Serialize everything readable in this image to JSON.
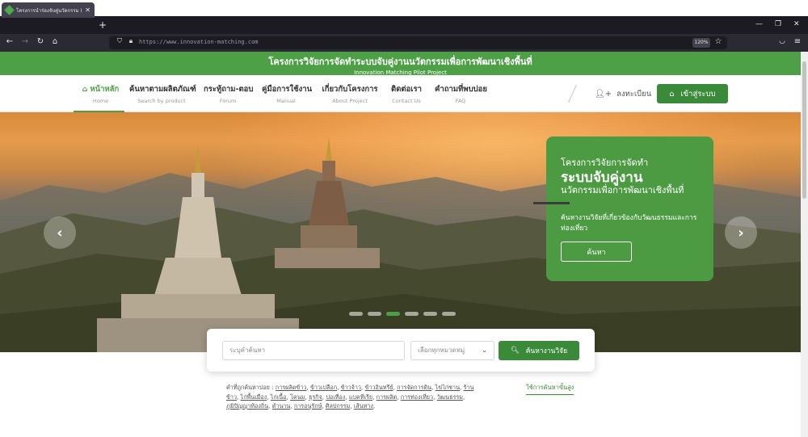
{
  "browser": {
    "tab_title": "โครงการนำร่องจับคู่นวัตกรรม (Inn",
    "url": "https://www.innovation-matching.com",
    "zoom": "120%"
  },
  "site": {
    "title_th": "โครงการวิจัยการจัดทำระบบจับคู่งานนวัตกรรมเพื่อการพัฒนาเชิงพื้นที่",
    "title_en": "Innovation Matching Pilot Project"
  },
  "nav": [
    {
      "th": "หน้าหลัก",
      "en": "Home"
    },
    {
      "th": "ค้นหาตามผลิตภัณฑ์",
      "en": "Search by product"
    },
    {
      "th": "กระทู้ถาม-ตอบ",
      "en": "Forum"
    },
    {
      "th": "คู่มือการใช้งาน",
      "en": "Manual"
    },
    {
      "th": "เกี่ยวกับโครงการ",
      "en": "About Project"
    },
    {
      "th": "ติดต่อเรา",
      "en": "Contact Us"
    },
    {
      "th": "คำถามที่พบบ่อย",
      "en": "FAQ"
    }
  ],
  "auth": {
    "register": "ลงทะเบียน",
    "login": "เข้าสู่ระบบ"
  },
  "hero": {
    "line1": "โครงการวิจัยการจัดทำ",
    "line2": "ระบบจับคู่งาน",
    "line3": "นวัตกรรมเพื่อการพัฒนาเชิงพื้นที่",
    "desc": "ค้นหางานวิจัยที่เกี่ยวข้องกับวัฒนธรรมและการท่องเที่ยว",
    "button": "ค้นหา",
    "prev": "‹",
    "next": "›",
    "slide_count": 6,
    "active_slide": 3
  },
  "search": {
    "keyword_placeholder": "ระบุคำค้นหา",
    "category_placeholder": "เลือกทุกหมวดหมู่",
    "button": "ค้นหางานวิจัย"
  },
  "popular": {
    "label": "คำที่ถูกค้นหาบ่อย :",
    "terms": [
      "การผลิตข้าว",
      "ข้าวเปลือก",
      "ข้าวจ้าว",
      "ข้าวอินทรีย์",
      "การจัดการดิน",
      "ไข่ไก่ชาน",
      "ร้านข้าว",
      "ไก่พื้นเมือง",
      "ไก่เนื้อ",
      "โคนม",
      "ธุรกิจ",
      "ปอเทือง",
      "แบคทีเรีย",
      "การผลิต",
      "การท่องเที่ยว",
      "วัฒนธรรม",
      "ภูมิปัญญาท้องถิ่น",
      "ตำนาน",
      "การอนุรักษ์",
      "ศิลปกรรม",
      "เส้นทาง"
    ],
    "advanced": "ใช้การค้นหาขั้นสูง"
  },
  "colors": {
    "brand_green": "#4ea046",
    "button_green": "#3b8a3a"
  }
}
